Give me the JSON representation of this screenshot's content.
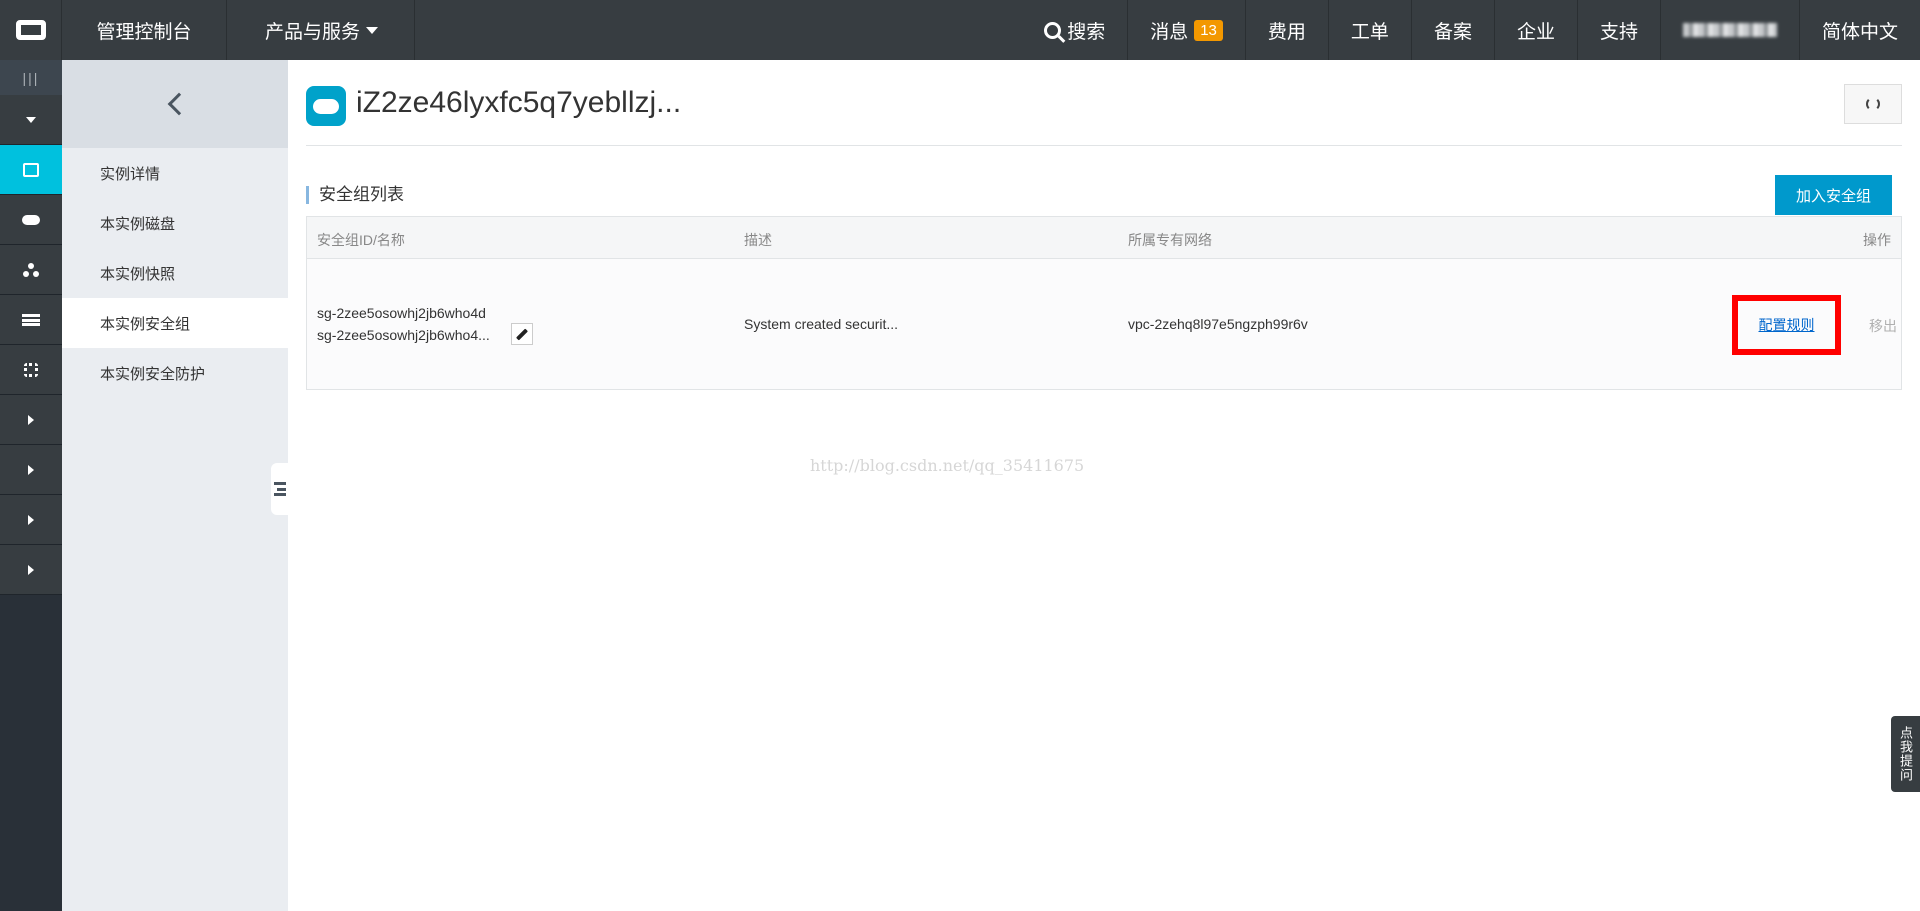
{
  "topbar": {
    "console": "管理控制台",
    "products": "产品与服务",
    "search": "搜索",
    "messages": "消息",
    "message_count": "13",
    "items": [
      "费用",
      "工单",
      "备案",
      "企业",
      "支持"
    ],
    "language": "简体中文"
  },
  "rail": {
    "toggle": "|||",
    "icons": [
      "dropdown-icon",
      "server-icon",
      "cloud-icon",
      "network-icon",
      "storage-icon",
      "gear-icon"
    ]
  },
  "subnav": {
    "items": [
      {
        "label": "实例详情"
      },
      {
        "label": "本实例磁盘"
      },
      {
        "label": "本实例快照"
      },
      {
        "label": "本实例安全组",
        "active": true
      },
      {
        "label": "本实例安全防护"
      }
    ]
  },
  "main": {
    "title": "iZ2ze46lyxfc5q7yebllzj...",
    "section_title": "安全组列表",
    "add_button": "加入安全组",
    "table": {
      "headers": [
        "安全组ID/名称",
        "描述",
        "所属专有网络",
        "操作"
      ],
      "rows": [
        {
          "id": "sg-2zee5osowhj2jb6who4d",
          "name": "sg-2zee5osowhj2jb6who4...",
          "description": "System created securit...",
          "vpc": "vpc-2zehq8l97e5ngzph99r6v",
          "action_config": "配置规则",
          "action_remove": "移出"
        }
      ]
    }
  },
  "watermark": "http://blog.csdn.net/qq_35411675",
  "help_tab": "点我提问",
  "colors": {
    "topbar": "#373d41",
    "rail_active": "#00c1de",
    "primary_button": "#0099cc",
    "badge": "#f39800",
    "highlight": "#ff0000"
  }
}
